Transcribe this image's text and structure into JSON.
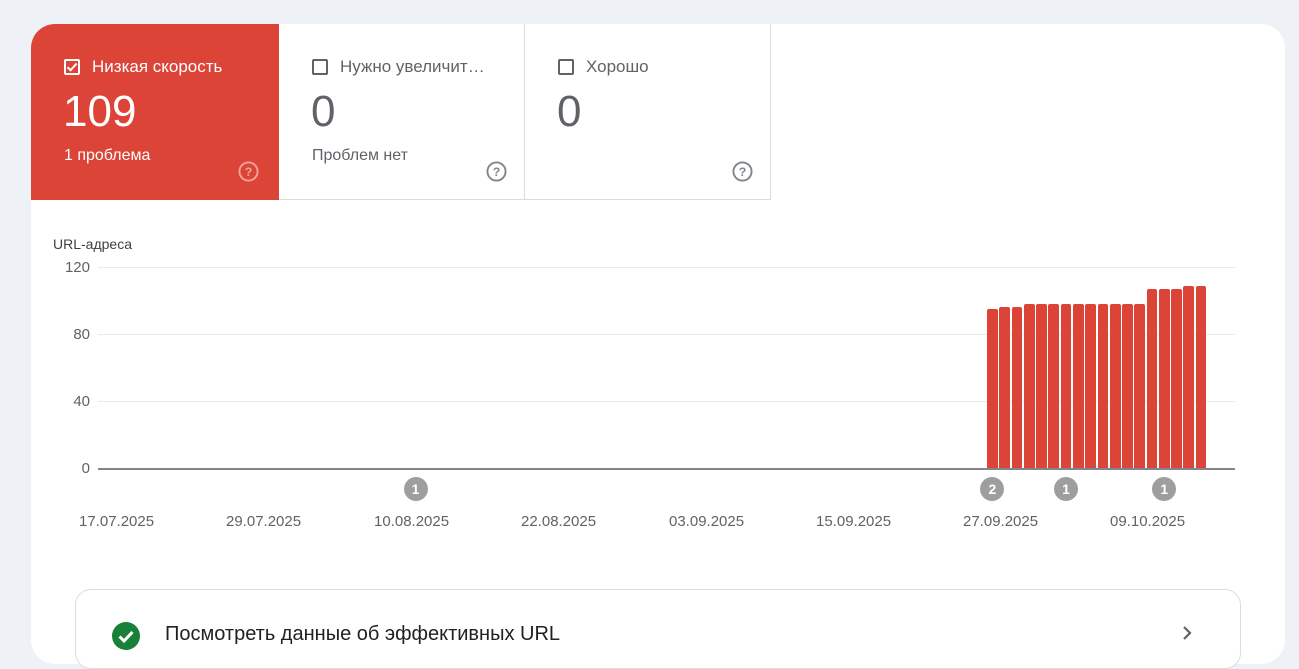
{
  "tiles": [
    {
      "label": "Низкая скорость",
      "count": "109",
      "sub": "1 проблема",
      "checked": true
    },
    {
      "label": "Нужно увеличит…",
      "count": "0",
      "sub": "Проблем нет",
      "checked": false
    },
    {
      "label": "Хорошо",
      "count": "0",
      "sub": "",
      "checked": false
    }
  ],
  "chart_data": {
    "type": "bar",
    "ylabel": "URL-адреса",
    "ylim": [
      0,
      120
    ],
    "y_ticks": [
      "120",
      "80",
      "40",
      "0"
    ],
    "x_ticks": [
      "17.07.2025",
      "29.07.2025",
      "10.08.2025",
      "22.08.2025",
      "03.09.2025",
      "15.09.2025",
      "27.09.2025",
      "09.10.2025"
    ],
    "x_range": [
      "16.07.2025",
      "19.10.2025"
    ],
    "series": [
      {
        "color": "#db4437",
        "x": [
          "26.09.2025",
          "27.09.2025",
          "28.09.2025",
          "29.09.2025",
          "30.09.2025",
          "01.10.2025",
          "02.10.2025",
          "03.10.2025",
          "04.10.2025",
          "05.10.2025",
          "06.10.2025",
          "07.10.2025",
          "08.10.2025",
          "09.10.2025",
          "10.10.2025",
          "11.10.2025",
          "12.10.2025",
          "13.10.2025"
        ],
        "values": [
          95,
          96,
          96,
          98,
          98,
          98,
          98,
          98,
          98,
          98,
          98,
          98,
          98,
          107,
          107,
          107,
          109,
          109
        ]
      }
    ],
    "annotations": [
      {
        "date": "10.08.2025",
        "label": "1"
      },
      {
        "date": "26.09.2025",
        "label": "2"
      },
      {
        "date": "02.10.2025",
        "label": "1"
      },
      {
        "date": "10.10.2025",
        "label": "1"
      }
    ]
  },
  "bottom_card": {
    "text": "Посмотреть данные об эффективных URL"
  }
}
